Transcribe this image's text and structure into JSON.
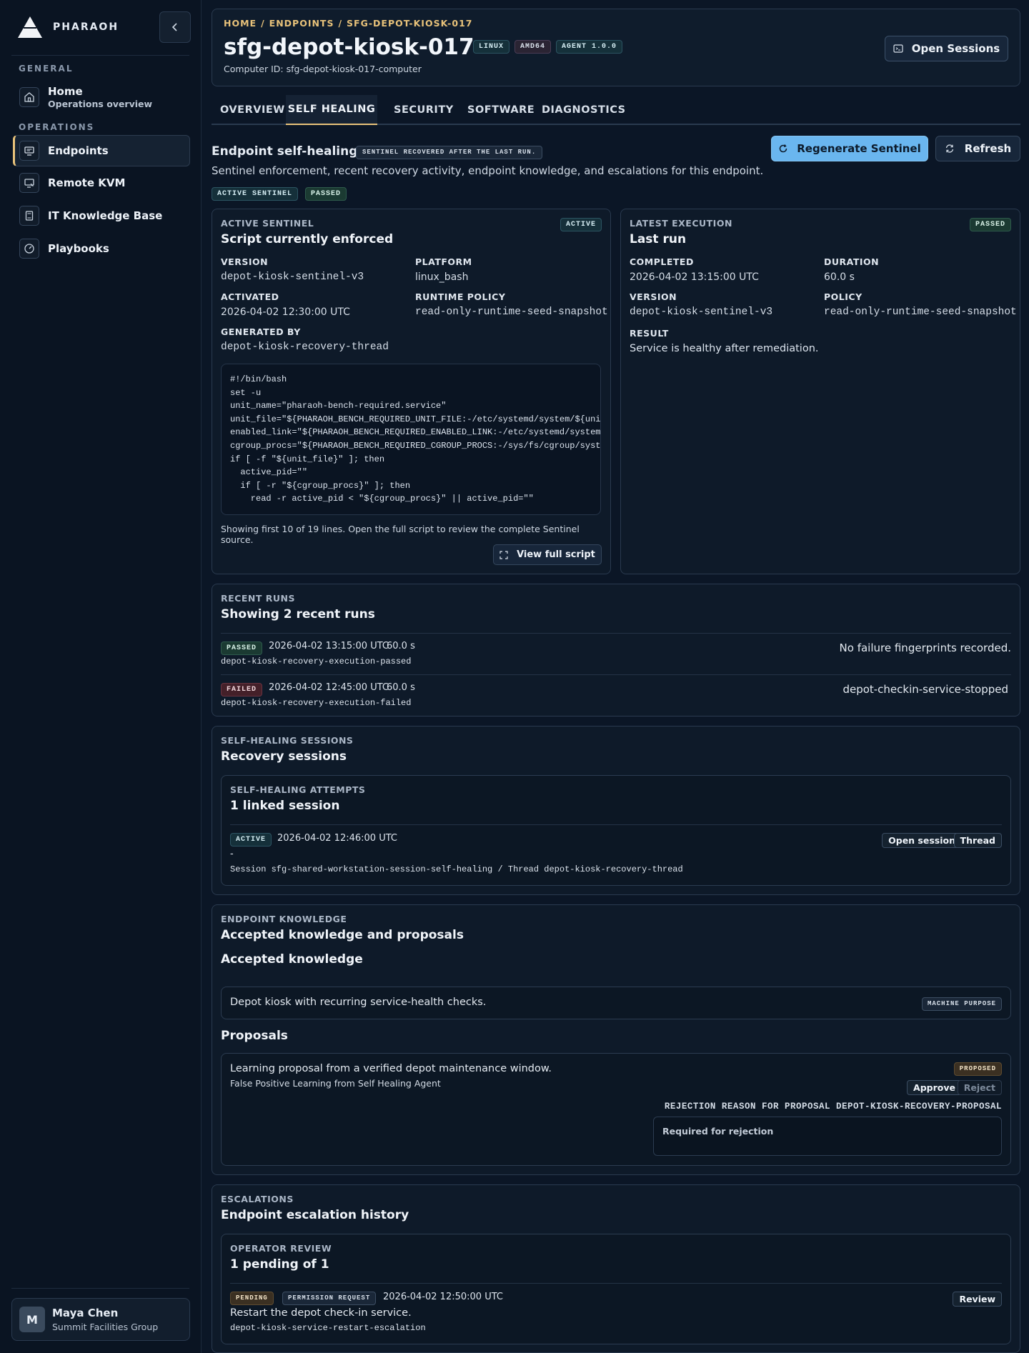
{
  "brand": {
    "name": "PHARAOH"
  },
  "sidebar": {
    "general_heading": "GENERAL",
    "operations_heading": "OPERATIONS",
    "home": {
      "label": "Home",
      "sub": "Operations overview"
    },
    "items": [
      {
        "label": "Endpoints",
        "icon": "monitor-icon"
      },
      {
        "label": "Remote KVM",
        "icon": "remote-screen-icon"
      },
      {
        "label": "IT Knowledge Base",
        "icon": "book-icon"
      },
      {
        "label": "Playbooks",
        "icon": "gauge-icon"
      }
    ],
    "user": {
      "initial": "M",
      "name": "Maya Chen",
      "org": "Summit Facilities Group"
    }
  },
  "header": {
    "breadcrumb": [
      "HOME",
      "ENDPOINTS",
      "SFG-DEPOT-KIOSK-017"
    ],
    "title": "sfg-depot-kiosk-017",
    "tags": [
      "LINUX",
      "AMD64",
      "AGENT 1.0.0"
    ],
    "computer_id": "Computer ID: sfg-depot-kiosk-017-computer",
    "open_sessions": "Open Sessions"
  },
  "tabs": [
    "OVERVIEW",
    "SELF HEALING",
    "SECURITY",
    "SOFTWARE",
    "DIAGNOSTICS"
  ],
  "active_tab": "SELF HEALING",
  "self_healing": {
    "title": "Endpoint self-healing",
    "badge": "SENTINEL RECOVERED AFTER THE LAST RUN.",
    "description": "Sentinel enforcement, recent recovery activity, endpoint knowledge, and escalations for this endpoint.",
    "chips": [
      "ACTIVE SENTINEL",
      "PASSED"
    ],
    "regenerate": "Regenerate Sentinel",
    "refresh": "Refresh"
  },
  "active_sentinel": {
    "label": "ACTIVE SENTINEL",
    "status": "ACTIVE",
    "title": "Script currently enforced",
    "version_label": "VERSION",
    "version": "depot-kiosk-sentinel-v3",
    "platform_label": "PLATFORM",
    "platform": "linux_bash",
    "activated_label": "ACTIVATED",
    "activated": "2026-04-02 12:30:00 UTC",
    "policy_label": "RUNTIME POLICY",
    "policy": "read-only-runtime-seed-snapshot",
    "generated_label": "GENERATED BY",
    "generated": "depot-kiosk-recovery-thread",
    "code": [
      "#!/bin/bash",
      "set -u",
      "unit_name=\"pharaoh-bench-required.service\"",
      "unit_file=\"${PHARAOH_BENCH_REQUIRED_UNIT_FILE:-/etc/systemd/system/${unit_name}}\"",
      "enabled_link=\"${PHARAOH_BENCH_REQUIRED_ENABLED_LINK:-/etc/systemd/system/multi-user.target.wants/${unit_name}}\"",
      "cgroup_procs=\"${PHARAOH_BENCH_REQUIRED_CGROUP_PROCS:-/sys/fs/cgroup/system.slice/${unit_name}/cgroup.procs}\"",
      "if [ -f \"${unit_file}\" ]; then",
      "  active_pid=\"\"",
      "  if [ -r \"${cgroup_procs}\" ]; then",
      "    read -r active_pid < \"${cgroup_procs}\" || active_pid=\"\""
    ],
    "note": "Showing first 10 of 19 lines. Open the full script to review the complete Sentinel source.",
    "view_full": "View full script"
  },
  "latest_execution": {
    "label": "LATEST EXECUTION",
    "status": "PASSED",
    "title": "Last run",
    "completed_label": "COMPLETED",
    "completed": "2026-04-02 13:15:00 UTC",
    "duration_label": "DURATION",
    "duration": "60.0 s",
    "version_label": "VERSION",
    "version": "depot-kiosk-sentinel-v3",
    "policy_label": "POLICY",
    "policy": "read-only-runtime-seed-snapshot",
    "result_label": "RESULT",
    "result": "Service is healthy after remediation."
  },
  "recent_runs": {
    "label": "RECENT RUNS",
    "title": "Showing 2 recent runs",
    "runs": [
      {
        "status": "PASSED",
        "time": "2026-04-02 13:15:00 UTC",
        "duration": "60.0 s",
        "id": "depot-kiosk-recovery-execution-passed",
        "detail": "No failure fingerprints recorded."
      },
      {
        "status": "FAILED",
        "time": "2026-04-02 12:45:00 UTC",
        "duration": "60.0 s",
        "id": "depot-kiosk-recovery-execution-failed",
        "detail": "depot-checkin-service-stopped"
      }
    ]
  },
  "sessions": {
    "label": "SELF-HEALING SESSIONS",
    "title": "Recovery sessions",
    "attempts_label": "SELF-HEALING ATTEMPTS",
    "attempts_title": "1 linked session",
    "item": {
      "status": "ACTIVE",
      "time": "2026-04-02 12:46:00 UTC",
      "dash": "-",
      "detail": "Session sfg-shared-workstation-session-self-healing / Thread depot-kiosk-recovery-thread",
      "open": "Open session",
      "thread": "Thread"
    }
  },
  "knowledge": {
    "label": "ENDPOINT KNOWLEDGE",
    "title": "Accepted knowledge and proposals",
    "accepted_heading": "Accepted knowledge",
    "accepted_text": "Depot kiosk with recurring service-health checks.",
    "accepted_tag": "MACHINE PURPOSE",
    "proposals_heading": "Proposals",
    "proposal": {
      "text": "Learning proposal from a verified depot maintenance window.",
      "source": "False Positive Learning from Self Healing Agent",
      "status": "PROPOSED",
      "approve": "Approve",
      "reject": "Reject",
      "rejection_label": "REJECTION REASON FOR PROPOSAL DEPOT-KIOSK-RECOVERY-PROPOSAL",
      "rejection_placeholder": "Required for rejection"
    }
  },
  "escalations": {
    "label": "ESCALATIONS",
    "title": "Endpoint escalation history",
    "review_label": "OPERATOR REVIEW",
    "review_title": "1 pending of 1",
    "item": {
      "status": "PENDING",
      "type": "PERMISSION REQUEST",
      "time": "2026-04-02 12:50:00 UTC",
      "text": "Restart the depot check-in service.",
      "id": "depot-kiosk-service-restart-escalation",
      "review": "Review"
    }
  },
  "colors": {
    "accent": "#e8c27a",
    "primary_button": "#6ab6ef",
    "background": "#0b1626"
  }
}
